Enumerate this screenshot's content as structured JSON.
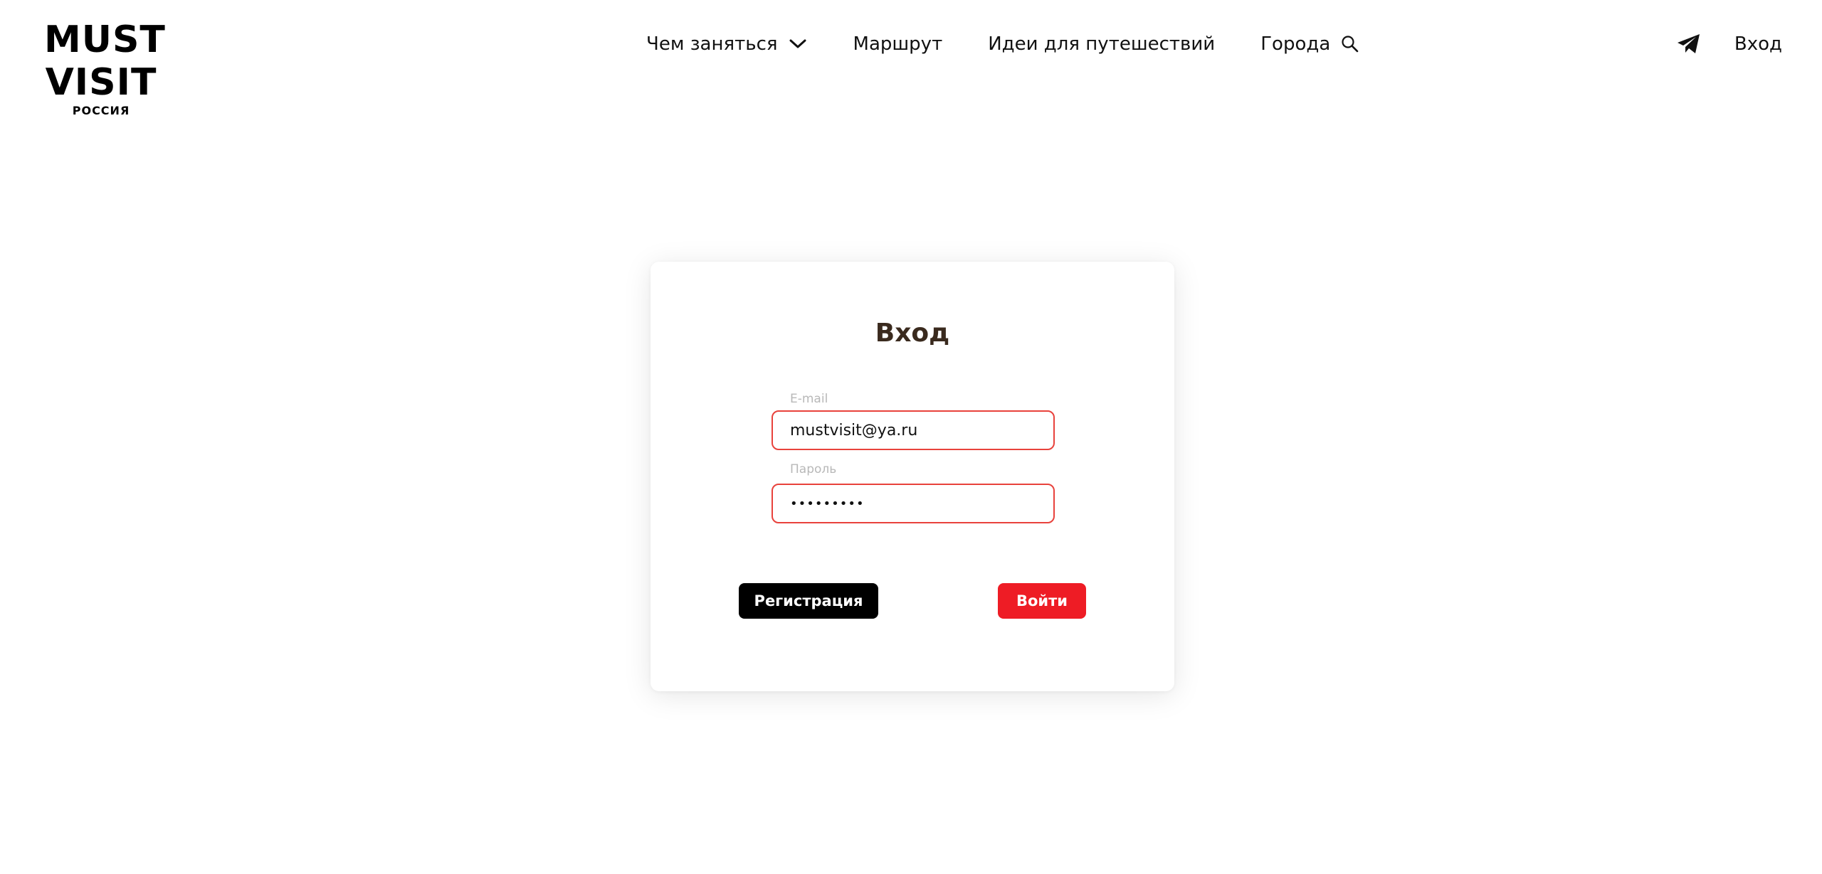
{
  "logo": {
    "line1": "MUST",
    "line2": "VISIT",
    "sub": "РОССИЯ"
  },
  "nav": {
    "items": [
      {
        "label": "Чем заняться",
        "icon": "chevron-down-icon"
      },
      {
        "label": "Маршрут"
      },
      {
        "label": "Идеи для путешествий"
      },
      {
        "label": "Города",
        "icon": "search-icon"
      }
    ]
  },
  "header_right": {
    "telegram_icon": "telegram-icon",
    "login_label": "Вход"
  },
  "login_form": {
    "title": "Вход",
    "email": {
      "label": "E-mail",
      "value": "mustvisit@ya.ru"
    },
    "password": {
      "label": "Пароль",
      "value": "•••••••••"
    },
    "register_button": "Регистрация",
    "submit_button": "Войти"
  },
  "colors": {
    "accent_red": "#ee1c25",
    "field_border": "#e8423c",
    "title_brown": "#3a2a1e",
    "label_gray": "#b8b8b8",
    "black": "#000000"
  }
}
